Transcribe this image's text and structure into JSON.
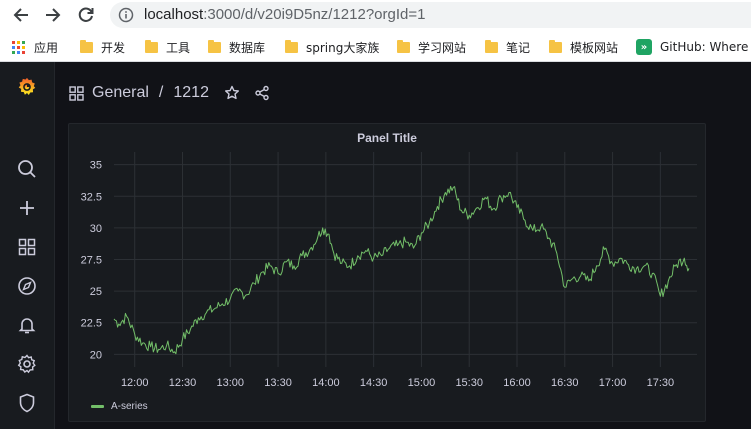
{
  "browser": {
    "url_host": "localhost",
    "url_path": ":3000/d/v20i9D5nz/1212?orgId=1",
    "bookmarks": [
      {
        "label": "应用",
        "icon": "apps-grid-icon"
      },
      {
        "label": "开发",
        "icon": "folder-icon"
      },
      {
        "label": "工具",
        "icon": "folder-icon"
      },
      {
        "label": "数据库",
        "icon": "folder-icon"
      },
      {
        "label": "spring大家族",
        "icon": "folder-icon"
      },
      {
        "label": "学习网站",
        "icon": "folder-icon"
      },
      {
        "label": "笔记",
        "icon": "folder-icon"
      },
      {
        "label": "模板网站",
        "icon": "folder-icon"
      },
      {
        "label": "GitHub: Where t",
        "icon": "github-bookmark-icon"
      }
    ]
  },
  "sidebar": {
    "items": [
      "grafana-logo-icon",
      "search-icon",
      "plus-icon",
      "dashboards-icon",
      "explore-compass-icon",
      "alerting-bell-icon",
      "configuration-gear-icon",
      "server-admin-shield-icon"
    ]
  },
  "dashboard": {
    "folder": "General",
    "separator": "/",
    "name": "1212",
    "icons": [
      "star-icon",
      "share-icon",
      "dashboard-grid-icon"
    ]
  },
  "panel": {
    "title": "Panel Title"
  },
  "colors": {
    "series": "#73bf69",
    "grid": "#2c3035",
    "text": "#ccccdc",
    "panel_bg": "#181b1f",
    "page_bg": "#111217"
  },
  "chart_data": {
    "type": "line",
    "title": "Panel Title",
    "xlabel": "",
    "ylabel": "",
    "x_ticks": [
      "12:00",
      "12:30",
      "13:00",
      "13:30",
      "14:00",
      "14:30",
      "15:00",
      "15:30",
      "16:00",
      "16:30",
      "17:00",
      "17:30"
    ],
    "y_ticks": [
      20,
      22.5,
      25,
      27.5,
      30,
      32.5,
      35
    ],
    "ylim": [
      19,
      36
    ],
    "xlim": [
      "11:47",
      "17:53"
    ],
    "grid": true,
    "legend": "bottom-left",
    "series": [
      {
        "name": "A-series",
        "color": "#73bf69",
        "x": [
          "11:47",
          "11:50",
          "11:55",
          "12:00",
          "12:05",
          "12:10",
          "12:15",
          "12:20",
          "12:25",
          "12:30",
          "12:35",
          "12:40",
          "12:45",
          "12:50",
          "12:55",
          "13:00",
          "13:05",
          "13:10",
          "13:15",
          "13:20",
          "13:25",
          "13:30",
          "13:35",
          "13:40",
          "13:45",
          "13:50",
          "13:55",
          "13:58",
          "14:02",
          "14:05",
          "14:10",
          "14:15",
          "14:20",
          "14:25",
          "14:30",
          "14:35",
          "14:40",
          "14:45",
          "14:50",
          "14:55",
          "15:00",
          "15:05",
          "15:10",
          "15:15",
          "15:20",
          "15:25",
          "15:30",
          "15:35",
          "15:40",
          "15:45",
          "15:50",
          "15:55",
          "16:00",
          "16:05",
          "16:10",
          "16:15",
          "16:20",
          "16:25",
          "16:30",
          "16:35",
          "16:40",
          "16:45",
          "16:50",
          "16:55",
          "17:00",
          "17:05",
          "17:10",
          "17:15",
          "17:20",
          "17:25",
          "17:30",
          "17:35",
          "17:40",
          "17:45",
          "17:48"
        ],
        "values": [
          22.8,
          22.4,
          23.0,
          21.6,
          20.9,
          20.6,
          20.4,
          20.7,
          20.2,
          21.2,
          22.0,
          22.9,
          23.3,
          23.6,
          24.0,
          24.4,
          25.0,
          24.7,
          25.6,
          26.5,
          27.0,
          26.4,
          27.3,
          27.0,
          27.8,
          28.3,
          29.3,
          30.0,
          29.5,
          28.0,
          27.2,
          27.0,
          27.8,
          28.2,
          27.6,
          27.8,
          28.4,
          28.6,
          28.9,
          28.4,
          29.6,
          30.4,
          31.7,
          32.8,
          33.2,
          31.4,
          31.0,
          31.6,
          32.4,
          31.5,
          32.4,
          32.8,
          31.6,
          30.6,
          29.8,
          30.1,
          29.2,
          28.0,
          25.3,
          26.0,
          26.2,
          25.8,
          27.0,
          28.3,
          27.2,
          27.6,
          27.1,
          26.8,
          27.0,
          26.4,
          24.6,
          25.8,
          27.1,
          27.6,
          26.8
        ]
      }
    ]
  }
}
